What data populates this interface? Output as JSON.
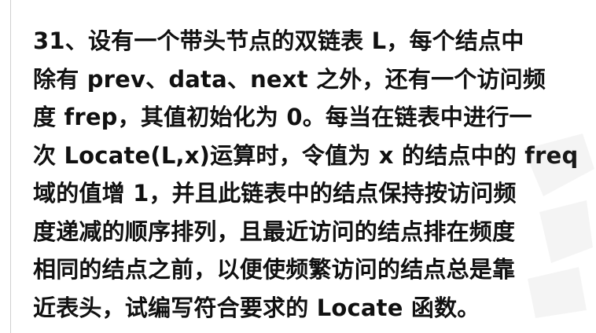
{
  "question": {
    "lines": [
      "31、设有一个带头节点的双链表 L，每个结点中",
      "除有 prev、data、next 之外，还有一个访问频",
      "度 frep，其值初始化为 0。每当在链表中进行一",
      "次 Locate(L,x)运算时，令值为 x 的结点中的 freq",
      "域的值增 1，并且此链表中的结点保持按访问频",
      "度递减的顺序排列，且最近访问的结点排在频度",
      "相同的结点之前，以便使频繁访问的结点总是靠",
      "近表头，试编写符合要求的 Locate 函数。"
    ]
  }
}
